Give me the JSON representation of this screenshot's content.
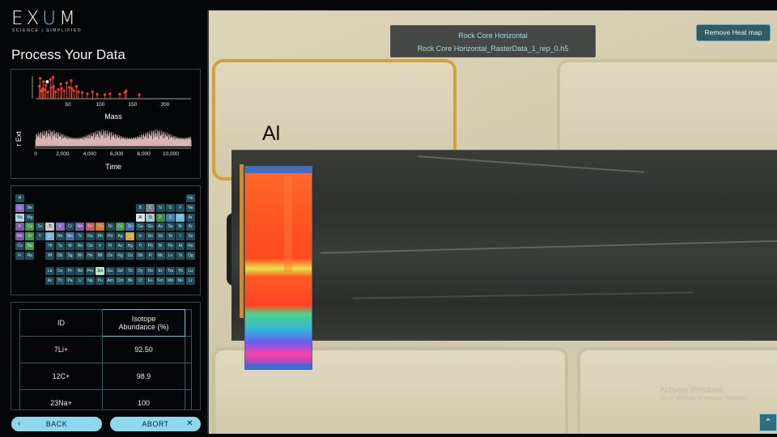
{
  "app": {
    "logo": {
      "prefix": "EX",
      "accent": "U",
      "suffix": "M"
    },
    "tagline": "SCIENCE | SIMPLIFIED",
    "title": "Process Your Data"
  },
  "colors": {
    "accent": "#5fc3dc",
    "button": "#8ed7ec",
    "heat_button": "#2f5b66"
  },
  "charts": [
    {
      "type": "scatter",
      "xlabel": "Mass",
      "ylabel": "",
      "xticks": [
        "50",
        "100",
        "150",
        "200"
      ],
      "xlim": [
        0,
        240
      ],
      "peaks": [
        [
          6,
          0.55
        ],
        [
          7,
          0.9
        ],
        [
          9,
          0.35
        ],
        [
          11,
          0.45
        ],
        [
          12,
          0.75
        ],
        [
          14,
          0.4
        ],
        [
          16,
          0.6
        ],
        [
          19,
          0.3
        ],
        [
          23,
          0.85
        ],
        [
          24,
          0.5
        ],
        [
          27,
          0.95
        ],
        [
          28,
          0.55
        ],
        [
          31,
          0.3
        ],
        [
          35,
          0.4
        ],
        [
          39,
          0.65
        ],
        [
          40,
          0.45
        ],
        [
          44,
          0.35
        ],
        [
          48,
          0.7
        ],
        [
          52,
          0.5
        ],
        [
          55,
          0.8
        ],
        [
          56,
          0.45
        ],
        [
          59,
          0.35
        ],
        [
          63,
          0.55
        ],
        [
          66,
          0.3
        ],
        [
          72,
          0.28
        ],
        [
          80,
          0.22
        ],
        [
          88,
          0.3
        ],
        [
          95,
          0.2
        ],
        [
          107,
          0.18
        ],
        [
          115,
          0.22
        ],
        [
          130,
          0.2
        ],
        [
          138,
          0.28
        ],
        [
          140,
          0.35
        ],
        [
          160,
          0.18
        ]
      ]
    },
    {
      "type": "line",
      "xlabel": "Time",
      "ylabel": "r Ext",
      "xticks": [
        "0",
        "2,000",
        "4,000",
        "6,000",
        "8,000",
        "10,000"
      ],
      "xlim": [
        0,
        11500
      ]
    }
  ],
  "periodic_table": [
    {
      "s": "H",
      "r": 0,
      "c": 0
    },
    {
      "s": "He",
      "r": 0,
      "c": 17
    },
    {
      "s": "Li",
      "r": 1,
      "c": 0,
      "col": "#8d6cc0"
    },
    {
      "s": "Be",
      "r": 1,
      "c": 1
    },
    {
      "s": "B",
      "r": 1,
      "c": 12
    },
    {
      "s": "C",
      "r": 1,
      "c": 13,
      "col": "#6e7f86"
    },
    {
      "s": "N",
      "r": 1,
      "c": 14
    },
    {
      "s": "O",
      "r": 1,
      "c": 15
    },
    {
      "s": "F",
      "r": 1,
      "c": 16
    },
    {
      "s": "Ne",
      "r": 1,
      "c": 17
    },
    {
      "s": "Na",
      "r": 2,
      "c": 0,
      "col": "#b7d7e3"
    },
    {
      "s": "Mg",
      "r": 2,
      "c": 1
    },
    {
      "s": "Al",
      "r": 2,
      "c": 12,
      "col": "#d6e3e7"
    },
    {
      "s": "Si",
      "r": 2,
      "c": 13,
      "col": "#aac6d0"
    },
    {
      "s": "P",
      "r": 2,
      "c": 14,
      "col": "#3f8a4e"
    },
    {
      "s": "S",
      "r": 2,
      "c": 15,
      "col": "#3d7fa6"
    },
    {
      "s": "Cl",
      "r": 2,
      "c": 16,
      "col": "#6fb8cf"
    },
    {
      "s": "Ar",
      "r": 2,
      "c": 17
    },
    {
      "s": "K",
      "r": 3,
      "c": 0,
      "col": "#7a5aa8"
    },
    {
      "s": "Ca",
      "r": 3,
      "c": 1,
      "col": "#3f9a52"
    },
    {
      "s": "Sc",
      "r": 3,
      "c": 2
    },
    {
      "s": "Ti",
      "r": 3,
      "c": 3,
      "col": "#c9c9c9"
    },
    {
      "s": "V",
      "r": 3,
      "c": 4,
      "col": "#8d6cc0"
    },
    {
      "s": "Cr",
      "r": 3,
      "c": 5
    },
    {
      "s": "Mn",
      "r": 3,
      "c": 6,
      "col": "#7c5ab0"
    },
    {
      "s": "Fe",
      "r": 3,
      "c": 7,
      "col": "#c05a5a"
    },
    {
      "s": "Co",
      "r": 3,
      "c": 8,
      "col": "#c67c2f"
    },
    {
      "s": "Ni",
      "r": 3,
      "c": 9
    },
    {
      "s": "Cu",
      "r": 3,
      "c": 10,
      "col": "#3f9a52"
    },
    {
      "s": "Zn",
      "r": 3,
      "c": 11,
      "col": "#3f6fa6"
    },
    {
      "s": "Ga",
      "r": 3,
      "c": 12
    },
    {
      "s": "Ge",
      "r": 3,
      "c": 13
    },
    {
      "s": "As",
      "r": 3,
      "c": 14
    },
    {
      "s": "Se",
      "r": 3,
      "c": 15
    },
    {
      "s": "Br",
      "r": 3,
      "c": 16
    },
    {
      "s": "Kr",
      "r": 3,
      "c": 17
    },
    {
      "s": "Rb",
      "r": 4,
      "c": 0,
      "col": "#7a5aa8"
    },
    {
      "s": "Sr",
      "r": 4,
      "c": 1,
      "col": "#3f9a52"
    },
    {
      "s": "Y",
      "r": 4,
      "c": 2
    },
    {
      "s": "Zr",
      "r": 4,
      "c": 3,
      "col": "#6fb8cf"
    },
    {
      "s": "Nb",
      "r": 4,
      "c": 4
    },
    {
      "s": "Mo",
      "r": 4,
      "c": 5,
      "col": "#3f6fa6"
    },
    {
      "s": "Tc",
      "r": 4,
      "c": 6
    },
    {
      "s": "Ru",
      "r": 4,
      "c": 7
    },
    {
      "s": "Rh",
      "r": 4,
      "c": 8
    },
    {
      "s": "Pd",
      "r": 4,
      "c": 9
    },
    {
      "s": "Ag",
      "r": 4,
      "c": 10
    },
    {
      "s": "Cd",
      "r": 4,
      "c": 11,
      "col": "#d9a63a"
    },
    {
      "s": "In",
      "r": 4,
      "c": 12
    },
    {
      "s": "Sn",
      "r": 4,
      "c": 13
    },
    {
      "s": "Sb",
      "r": 4,
      "c": 14
    },
    {
      "s": "Te",
      "r": 4,
      "c": 15
    },
    {
      "s": "I",
      "r": 4,
      "c": 16
    },
    {
      "s": "Xe",
      "r": 4,
      "c": 17
    },
    {
      "s": "Cs",
      "r": 5,
      "c": 0
    },
    {
      "s": "Ba",
      "r": 5,
      "c": 1,
      "col": "#3f9a52"
    },
    {
      "s": "Hf",
      "r": 5,
      "c": 3
    },
    {
      "s": "Ta",
      "r": 5,
      "c": 4
    },
    {
      "s": "W",
      "r": 5,
      "c": 5
    },
    {
      "s": "Re",
      "r": 5,
      "c": 6
    },
    {
      "s": "Os",
      "r": 5,
      "c": 7
    },
    {
      "s": "Ir",
      "r": 5,
      "c": 8
    },
    {
      "s": "Pt",
      "r": 5,
      "c": 9
    },
    {
      "s": "Au",
      "r": 5,
      "c": 10
    },
    {
      "s": "Hg",
      "r": 5,
      "c": 11
    },
    {
      "s": "Tl",
      "r": 5,
      "c": 12
    },
    {
      "s": "Pb",
      "r": 5,
      "c": 13
    },
    {
      "s": "Bi",
      "r": 5,
      "c": 14
    },
    {
      "s": "Po",
      "r": 5,
      "c": 15
    },
    {
      "s": "At",
      "r": 5,
      "c": 16
    },
    {
      "s": "Rn",
      "r": 5,
      "c": 17
    },
    {
      "s": "Fr",
      "r": 6,
      "c": 0
    },
    {
      "s": "Ra",
      "r": 6,
      "c": 1
    },
    {
      "s": "Rf",
      "r": 6,
      "c": 3
    },
    {
      "s": "Db",
      "r": 6,
      "c": 4
    },
    {
      "s": "Sg",
      "r": 6,
      "c": 5
    },
    {
      "s": "Bh",
      "r": 6,
      "c": 6
    },
    {
      "s": "Hs",
      "r": 6,
      "c": 7
    },
    {
      "s": "Mt",
      "r": 6,
      "c": 8
    },
    {
      "s": "Ds",
      "r": 6,
      "c": 9
    },
    {
      "s": "Rg",
      "r": 6,
      "c": 10
    },
    {
      "s": "Cn",
      "r": 6,
      "c": 11
    },
    {
      "s": "Nh",
      "r": 6,
      "c": 12
    },
    {
      "s": "Fl",
      "r": 6,
      "c": 13
    },
    {
      "s": "Mc",
      "r": 6,
      "c": 14
    },
    {
      "s": "Lv",
      "r": 6,
      "c": 15
    },
    {
      "s": "Ts",
      "r": 6,
      "c": 16
    },
    {
      "s": "Og",
      "r": 6,
      "c": 17
    },
    {
      "s": "La",
      "r": 8,
      "c": 3
    },
    {
      "s": "Ce",
      "r": 8,
      "c": 4
    },
    {
      "s": "Pr",
      "r": 8,
      "c": 5
    },
    {
      "s": "Nd",
      "r": 8,
      "c": 6
    },
    {
      "s": "Pm",
      "r": 8,
      "c": 7
    },
    {
      "s": "Sm",
      "r": 8,
      "c": 8,
      "col": "#b7e3cf"
    },
    {
      "s": "Eu",
      "r": 8,
      "c": 9
    },
    {
      "s": "Gd",
      "r": 8,
      "c": 10
    },
    {
      "s": "Tb",
      "r": 8,
      "c": 11
    },
    {
      "s": "Dy",
      "r": 8,
      "c": 12
    },
    {
      "s": "Ho",
      "r": 8,
      "c": 13
    },
    {
      "s": "Er",
      "r": 8,
      "c": 14
    },
    {
      "s": "Tm",
      "r": 8,
      "c": 15
    },
    {
      "s": "Yb",
      "r": 8,
      "c": 16
    },
    {
      "s": "Lu",
      "r": 8,
      "c": 17
    },
    {
      "s": "Ac",
      "r": 9,
      "c": 3
    },
    {
      "s": "Th",
      "r": 9,
      "c": 4
    },
    {
      "s": "Pa",
      "r": 9,
      "c": 5
    },
    {
      "s": "U",
      "r": 9,
      "c": 6
    },
    {
      "s": "Np",
      "r": 9,
      "c": 7
    },
    {
      "s": "Pu",
      "r": 9,
      "c": 8
    },
    {
      "s": "Am",
      "r": 9,
      "c": 9
    },
    {
      "s": "Cm",
      "r": 9,
      "c": 10
    },
    {
      "s": "Bk",
      "r": 9,
      "c": 11
    },
    {
      "s": "Cf",
      "r": 9,
      "c": 12
    },
    {
      "s": "Es",
      "r": 9,
      "c": 13
    },
    {
      "s": "Fm",
      "r": 9,
      "c": 14
    },
    {
      "s": "Md",
      "r": 9,
      "c": 15
    },
    {
      "s": "No",
      "r": 9,
      "c": 16
    },
    {
      "s": "Lr",
      "r": 9,
      "c": 17
    }
  ],
  "isotope_table": {
    "headers": {
      "id": "ID",
      "abundance_line1": "Isotope",
      "abundance_line2": "Abundance (%)"
    },
    "rows": [
      {
        "id": "7Li+",
        "abundance": "92.50"
      },
      {
        "id": "12C+",
        "abundance": "98.9"
      },
      {
        "id": "23Na+",
        "abundance": "100"
      }
    ]
  },
  "buttons": {
    "back": "BACK",
    "abort": "ABORT",
    "remove_heat_map": "Remove Heat map"
  },
  "viewer": {
    "element": "Al",
    "dataset_title": "Rock Core Horizontal",
    "dataset_file": "Rock Core Horizontal_RasterData_1_rep_0.h5"
  },
  "watermark": {
    "line1": "Activate Windows",
    "line2": "Go to Settings to activate Windows."
  }
}
